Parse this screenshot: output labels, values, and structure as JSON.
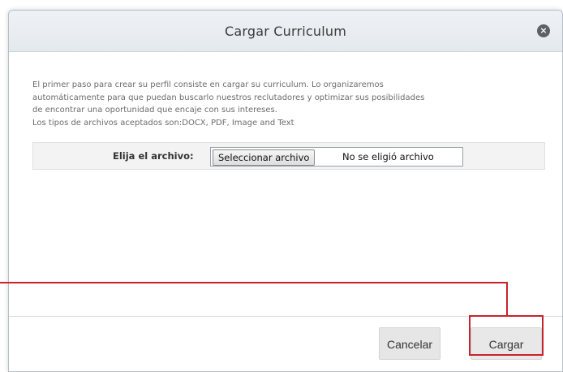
{
  "dialog": {
    "title": "Cargar Curriculum",
    "close_icon": "close-icon"
  },
  "description": {
    "lines": [
      "El primer paso para crear su perfil consiste en cargar su curriculum. Lo organizaremos",
      "automáticamente para que puedan buscarlo nuestros reclutadores y optimizar sus posibilidades",
      "de encontrar una oportunidad que encaje con sus intereses.",
      "Los tipos de archivos aceptados son:DOCX, PDF, Image and Text"
    ]
  },
  "file_picker": {
    "label": "Elija el archivo:",
    "button_label": "Seleccionar archivo",
    "status": "No se eligió archivo"
  },
  "footer": {
    "cancel_label": "Cancelar",
    "upload_label": "Cargar"
  },
  "annotation": {
    "highlight_color": "#c8232c"
  }
}
